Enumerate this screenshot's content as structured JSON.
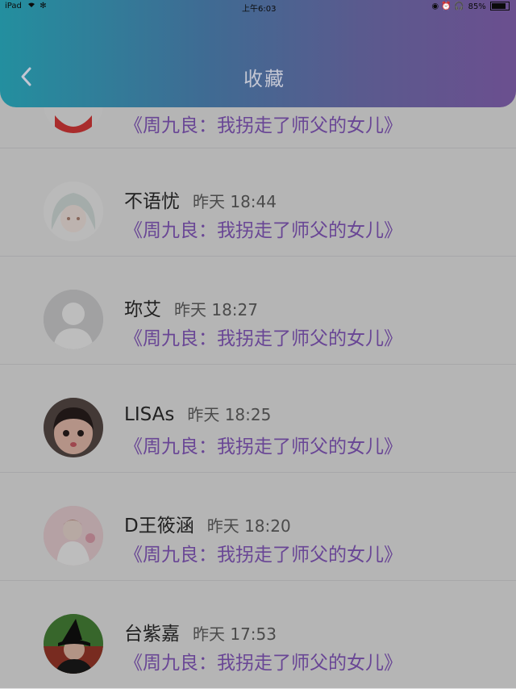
{
  "status_bar": {
    "device": "iPad",
    "time": "上午6:03",
    "battery": "85%"
  },
  "nav": {
    "title": "收藏",
    "back_icon": "chevron-left-icon"
  },
  "list": {
    "items": [
      {
        "name": "",
        "time": "",
        "title": "《周九良：我拐走了师父的女儿》",
        "avatar": "red-avatar"
      },
      {
        "name": "不语忧",
        "time": "昨天 18:44",
        "title": "《周九良：我拐走了师父的女儿》",
        "avatar": "anime-avatar"
      },
      {
        "name": "珎艾",
        "time": "昨天 18:27",
        "title": "《周九良：我拐走了师父的女儿》",
        "avatar": "default-avatar"
      },
      {
        "name": "LISAs",
        "time": "昨天 18:25",
        "title": "《周九良：我拐走了师父的女儿》",
        "avatar": "child-avatar"
      },
      {
        "name": "D王筱涵",
        "time": "昨天 18:20",
        "title": "《周九良：我拐走了师父的女儿》",
        "avatar": "baby-avatar"
      },
      {
        "name": "台紫嘉",
        "time": "昨天 17:53",
        "title": "《周九良：我拐走了师父的女儿》",
        "avatar": "witch-avatar"
      }
    ]
  },
  "colors": {
    "nav_gradient_start": "#238f9f",
    "nav_gradient_end": "#6b4f8f",
    "title_purple": "#8e5fc9",
    "dim_overlay": "rgba(0,0,0,0.26)"
  }
}
